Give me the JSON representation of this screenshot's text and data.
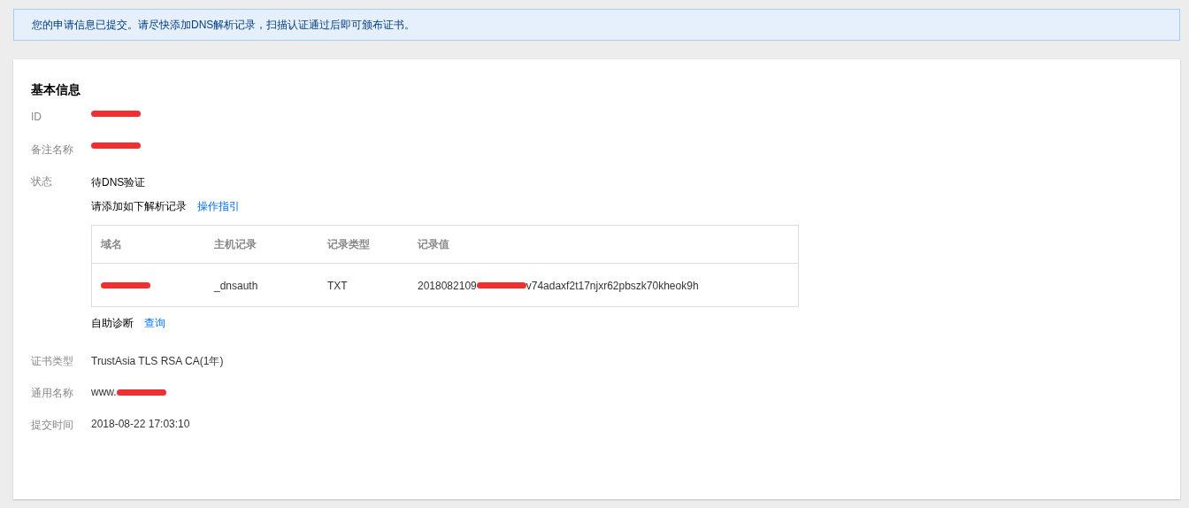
{
  "notice": "您的申请信息已提交。请尽快添加DNS解析记录，扫描认证通过后即可颁布证书。",
  "section_title": "基本信息",
  "fields_top": [
    {
      "label": "ID",
      "value": [
        {
          "kind": "redaction"
        }
      ]
    },
    {
      "label": "备注名称",
      "value": [
        {
          "kind": "redaction"
        }
      ]
    }
  ],
  "status": {
    "label": "状态",
    "value": "待DNS验证",
    "instruction": "请添加如下解析记录",
    "guide_link": "操作指引",
    "table": {
      "columns": [
        "域名",
        "主机记录",
        "记录类型",
        "记录值"
      ],
      "rows": [
        [
          [
            {
              "kind": "redaction"
            }
          ],
          [
            {
              "kind": "text",
              "text": "_dnsauth"
            }
          ],
          [
            {
              "kind": "text",
              "text": "TXT"
            }
          ],
          [
            {
              "kind": "text",
              "text": "2018082109"
            },
            {
              "kind": "redaction"
            },
            {
              "kind": "text",
              "text": "v74adaxf2t17njxr62pbszk70kheok9h"
            }
          ]
        ]
      ]
    },
    "diagnose_label": "自助诊断",
    "diagnose_link": "查询"
  },
  "fields_bottom": [
    {
      "label": "证书类型",
      "value": [
        {
          "kind": "text",
          "text": "TrustAsia TLS RSA CA(1年)"
        }
      ]
    },
    {
      "label": "通用名称",
      "value": [
        {
          "kind": "text",
          "text": "www."
        },
        {
          "kind": "redaction"
        }
      ]
    },
    {
      "label": "提交时间",
      "value": [
        {
          "kind": "text",
          "text": "2018-08-22 17:03:10"
        }
      ]
    }
  ]
}
